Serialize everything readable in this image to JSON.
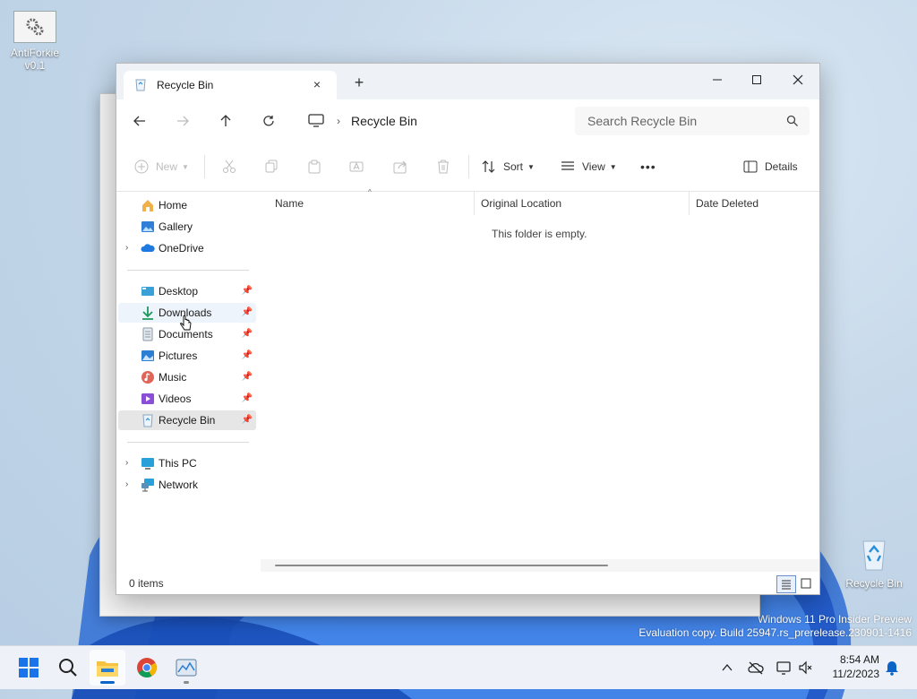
{
  "desktop": {
    "icons": [
      {
        "label": "AntiForkie v0.1",
        "icon": "gears-app-icon"
      },
      {
        "label": "Recycle Bin",
        "icon": "recycle-bin-icon"
      }
    ],
    "watermark": {
      "line1": "Windows 11 Pro Insider Preview",
      "line2": "Evaluation copy. Build 25947.rs_prerelease.230901-1416"
    }
  },
  "window": {
    "tab": {
      "title": "Recycle Bin",
      "close": "×"
    },
    "new_tab": "+",
    "address": {
      "crumb": "Recycle Bin"
    },
    "search": {
      "placeholder": "Search Recycle Bin"
    },
    "commands": {
      "new": "New",
      "sort": "Sort",
      "view": "View",
      "more": "•••",
      "details": "Details"
    },
    "sidebar": {
      "top": [
        {
          "label": "Home",
          "icon": "home-icon"
        },
        {
          "label": "Gallery",
          "icon": "gallery-icon"
        },
        {
          "label": "OneDrive",
          "icon": "onedrive-icon",
          "expandable": true
        }
      ],
      "quick_access": [
        {
          "label": "Desktop",
          "icon": "desktop-folder-icon",
          "pinned": true
        },
        {
          "label": "Downloads",
          "icon": "downloads-icon",
          "pinned": true
        },
        {
          "label": "Documents",
          "icon": "documents-icon",
          "pinned": true
        },
        {
          "label": "Pictures",
          "icon": "pictures-icon",
          "pinned": true
        },
        {
          "label": "Music",
          "icon": "music-icon",
          "pinned": true
        },
        {
          "label": "Videos",
          "icon": "videos-icon",
          "pinned": true
        },
        {
          "label": "Recycle Bin",
          "icon": "recycle-bin-icon",
          "pinned": true,
          "selected": true
        }
      ],
      "bottom": [
        {
          "label": "This PC",
          "icon": "this-pc-icon",
          "expandable": true
        },
        {
          "label": "Network",
          "icon": "network-icon",
          "expandable": true
        }
      ]
    },
    "columns": [
      "Name",
      "Original Location",
      "Date Deleted"
    ],
    "empty_message": "This folder is empty.",
    "status": {
      "items": "0 items"
    }
  },
  "taskbar": {
    "apps": [
      "start-icon",
      "search-icon",
      "file-explorer-icon",
      "chrome-icon",
      "task-manager-icon"
    ],
    "clock": {
      "time": "8:54 AM",
      "date": "11/2/2023"
    }
  },
  "colors": {
    "accent": "#0a64c8",
    "selection": "#e6e6e6"
  }
}
